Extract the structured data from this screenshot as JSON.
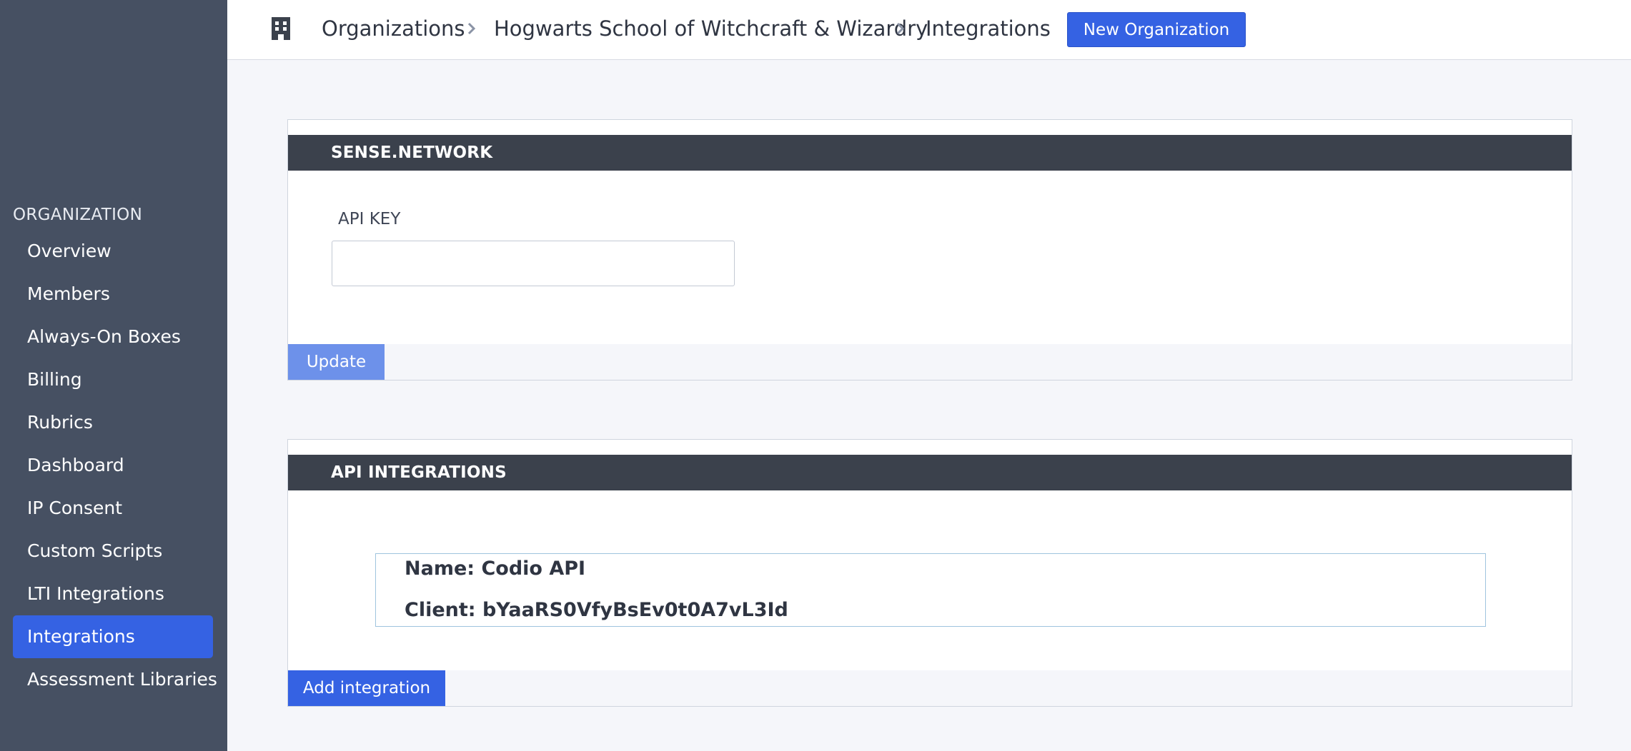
{
  "sidebar": {
    "section_title": "ORGANIZATION",
    "items": [
      {
        "label": "Overview"
      },
      {
        "label": "Members"
      },
      {
        "label": "Always-On Boxes"
      },
      {
        "label": "Billing"
      },
      {
        "label": "Rubrics"
      },
      {
        "label": "Dashboard"
      },
      {
        "label": "IP Consent"
      },
      {
        "label": "Custom Scripts"
      },
      {
        "label": "LTI Integrations"
      },
      {
        "label": "Integrations"
      },
      {
        "label": "Assessment Libraries"
      }
    ],
    "active_item": "Integrations"
  },
  "header": {
    "icon": "building-icon",
    "breadcrumb": [
      "Organizations",
      "Hogwarts School of Witchcraft & Wizardry",
      "Integrations"
    ],
    "new_org_label": "New Organization"
  },
  "sense_network": {
    "title": "SENSE.NETWORK",
    "api_key_label": "API KEY",
    "api_key_value": "",
    "update_label": "Update"
  },
  "api_integrations": {
    "title": "API INTEGRATIONS",
    "integrations": [
      {
        "name": "Name: Codio API",
        "client": "Client: bYaaRS0VfyBsEv0t0A7vL3Id"
      }
    ],
    "add_label": "Add integration"
  },
  "colors": {
    "sidebar_bg": "#465062",
    "accent": "#3562e3",
    "accent_disabled": "#6d91ea",
    "panel_header": "#3b414c",
    "page_bg": "#f5f6fa"
  }
}
